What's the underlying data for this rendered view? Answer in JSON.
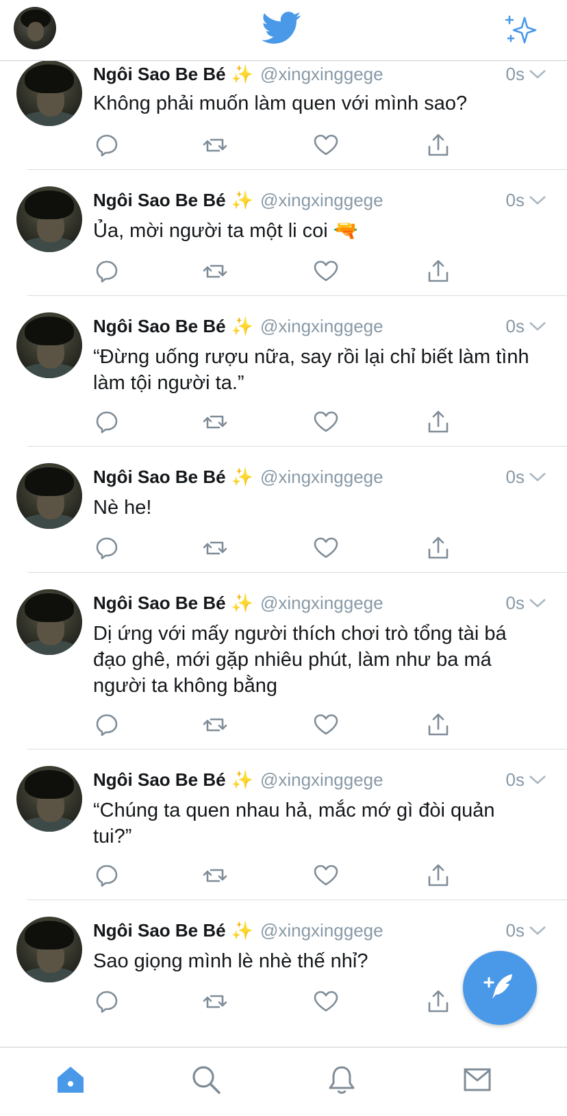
{
  "header": {
    "logo_icon": "twitter-bird-icon",
    "sparkle_icon": "sparkle-icon",
    "accent": "#4a99e9"
  },
  "tweets": [
    {
      "name": "Ngôi Sao Be Bé",
      "emoji": "✨",
      "handle": "@xingxinggege",
      "time": "0s",
      "text": "Không phải muốn làm quen với mình sao?"
    },
    {
      "name": "Ngôi Sao Be Bé",
      "emoji": "✨",
      "handle": "@xingxinggege",
      "time": "0s",
      "text": "Ủa, mời người ta một li coi 🔫"
    },
    {
      "name": "Ngôi Sao Be Bé",
      "emoji": "✨",
      "handle": "@xingxinggege",
      "time": "0s",
      "text": "“Đừng uống rượu nữa, say rồi lại chỉ biết làm tình làm tội người ta.”"
    },
    {
      "name": "Ngôi Sao Be Bé",
      "emoji": "✨",
      "handle": "@xingxinggege",
      "time": "0s",
      "text": "Nè he!"
    },
    {
      "name": "Ngôi Sao Be Bé",
      "emoji": "✨",
      "handle": "@xingxinggege",
      "time": "0s",
      "text": "Dị ứng với mấy người thích chơi trò tổng tài bá đạo ghê, mới gặp nhiêu phút, làm như ba má người ta không bằng"
    },
    {
      "name": "Ngôi Sao Be Bé",
      "emoji": "✨",
      "handle": "@xingxinggege",
      "time": "0s",
      "text": "“Chúng ta quen nhau hả, mắc mớ gì đòi quản tui?”"
    },
    {
      "name": "Ngôi Sao Be Bé",
      "emoji": "✨",
      "handle": "@xingxinggege",
      "time": "0s",
      "text": "Sao giọng mình lè nhè thế nhỉ?"
    }
  ],
  "actions_icons": [
    "reply-icon",
    "retweet-icon",
    "like-icon",
    "share-icon"
  ],
  "tabbar": {
    "items": [
      "home-icon",
      "search-icon",
      "notifications-icon",
      "messages-icon"
    ]
  },
  "fab": {
    "icon": "compose-tweet-icon"
  }
}
